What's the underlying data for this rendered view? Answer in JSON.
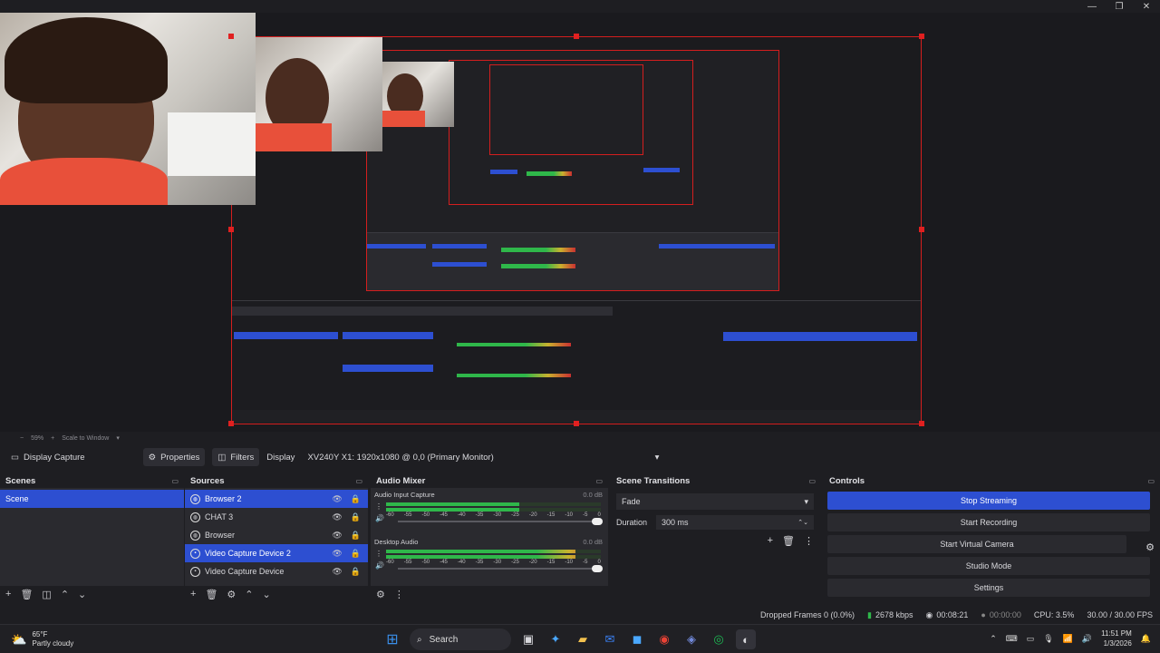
{
  "window": {
    "minimize": "—",
    "maximize": "❐",
    "close": "✕"
  },
  "preview": {
    "zoom": "59%",
    "scale_mode": "Scale to Window"
  },
  "source_bar": {
    "source_name": "Display Capture",
    "properties_label": "Properties",
    "filters_label": "Filters",
    "display_label": "Display",
    "display_value": "XV240Y X1: 1920x1080 @ 0,0 (Primary Monitor)"
  },
  "scenes": {
    "title": "Scenes",
    "items": [
      {
        "label": "Scene"
      }
    ]
  },
  "sources": {
    "title": "Sources",
    "items": [
      {
        "label": "Browser 2"
      },
      {
        "label": "CHAT 3"
      },
      {
        "label": "Browser"
      },
      {
        "label": "Video Capture Device 2"
      },
      {
        "label": "Video Capture Device"
      }
    ]
  },
  "mixer": {
    "title": "Audio Mixer",
    "tracks": [
      {
        "name": "Audio Input Capture",
        "db": "0.0 dB",
        "level": 0.62
      },
      {
        "name": "Desktop Audio",
        "db": "0.0 dB",
        "level": 0.88
      }
    ],
    "scale": [
      "-60",
      "-55",
      "-50",
      "-45",
      "-40",
      "-35",
      "-30",
      "-25",
      "-20",
      "-15",
      "-10",
      "-5",
      "0"
    ]
  },
  "transitions": {
    "title": "Scene Transitions",
    "type": "Fade",
    "duration_label": "Duration",
    "duration_value": "300 ms"
  },
  "controls": {
    "title": "Controls",
    "stop_streaming": "Stop Streaming",
    "start_recording": "Start Recording",
    "start_virtual_camera": "Start Virtual Camera",
    "studio_mode": "Studio Mode",
    "settings": "Settings"
  },
  "status": {
    "dropped_frames": "Dropped Frames 0 (0.0%)",
    "bitrate": "2678 kbps",
    "stream_time": "00:08:21",
    "record_time": "00:00:00",
    "cpu": "CPU: 3.5%",
    "fps": "30.00 / 30.00 FPS"
  },
  "taskbar": {
    "temp": "65°F",
    "weather": "Partly cloudy",
    "search_label": "Search",
    "time": "11:51 PM",
    "date": "1/3/2026"
  },
  "colors": {
    "accent": "#2d4fd1",
    "selection_border": "#d41e1e",
    "meter_green": "#2fb74a",
    "meter_yellow": "#c9b12e",
    "meter_red": "#c93030"
  }
}
